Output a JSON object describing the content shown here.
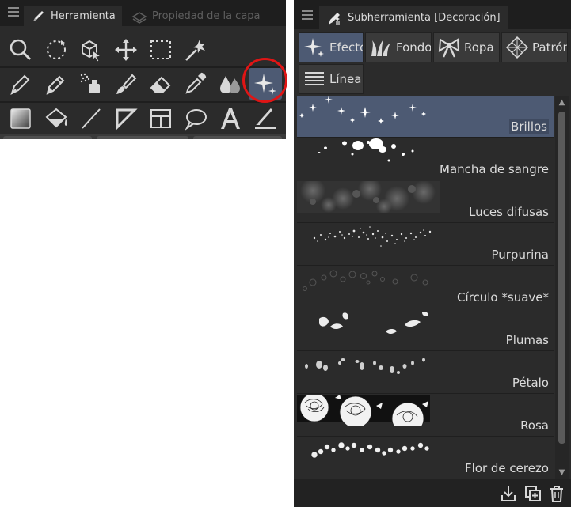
{
  "tool_panel": {
    "tabs": [
      {
        "label": "Herramienta",
        "icon": "pen-icon",
        "active": true
      },
      {
        "label": "Propiedad de la capa",
        "icon": "layer-property-icon",
        "active": false
      }
    ],
    "rows": [
      [
        "zoom-icon",
        "rotate-icon",
        "object-select-icon",
        "move-icon",
        "selection-rect-icon",
        "auto-select-wand-icon"
      ],
      [
        "pen-icon",
        "pencil-icon",
        "airbrush-icon",
        "brush-icon",
        "eraser-icon",
        "eyedropper-icon",
        "blend-icon",
        "decoration-sparkle-icon"
      ],
      [
        "gradient-icon",
        "fill-icon",
        "line-icon",
        "ruler-icon",
        "frame-border-icon",
        "speech-balloon-icon",
        "text-icon",
        "correct-line-icon"
      ]
    ],
    "selected_tool": "decoration-sparkle-icon"
  },
  "sub_panel": {
    "title": "Subherramienta [Decoración]",
    "title_icon": "decoration-tool-icon",
    "categories": [
      {
        "label": "Efecto",
        "icon": "sparkle-icon",
        "active": true
      },
      {
        "label": "Fondo",
        "icon": "grass-icon",
        "active": false
      },
      {
        "label": "Ropa",
        "icon": "bow-icon",
        "active": false
      },
      {
        "label": "Patrón",
        "icon": "pattern-icon",
        "active": false
      },
      {
        "label": "Línea",
        "icon": "lines-icon",
        "active": false
      }
    ],
    "items": [
      {
        "label": "Brillos",
        "selected": true
      },
      {
        "label": "Mancha de sangre",
        "selected": false
      },
      {
        "label": "Luces difusas",
        "selected": false
      },
      {
        "label": "Purpurina",
        "selected": false
      },
      {
        "label": "Círculo *suave*",
        "selected": false
      },
      {
        "label": "Plumas",
        "selected": false
      },
      {
        "label": "Pétalo",
        "selected": false
      },
      {
        "label": "Rosa",
        "selected": false
      },
      {
        "label": "Flor de cerezo",
        "selected": false
      }
    ],
    "footer_icons": [
      "import-icon",
      "duplicate-icon",
      "trash-icon"
    ]
  },
  "colors": {
    "panel_bg": "#2b2b2b",
    "selected_bg": "#4d5a73",
    "highlight_ring": "#e01515",
    "text": "#dcdcdc"
  }
}
